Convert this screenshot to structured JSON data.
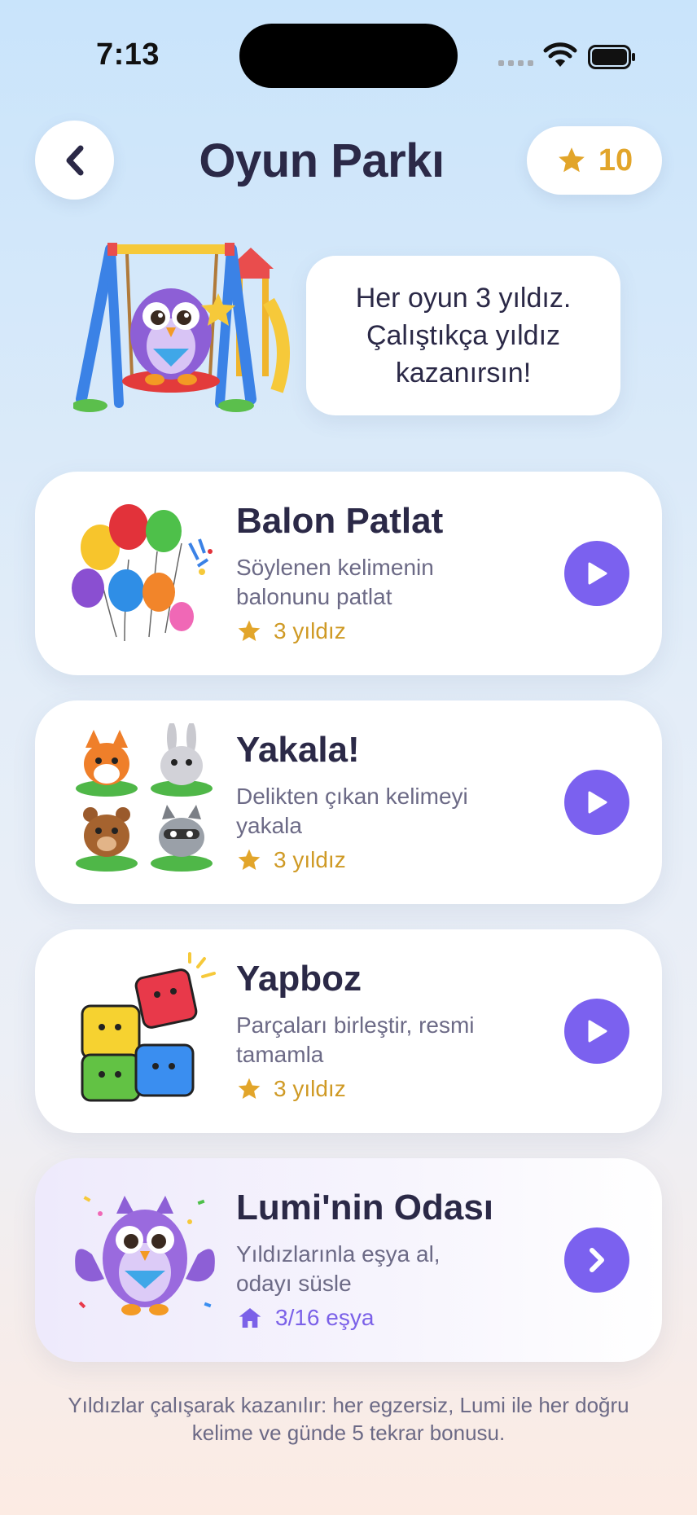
{
  "status_bar": {
    "time": "7:13"
  },
  "header": {
    "title": "Oyun Parkı",
    "stars": "10"
  },
  "hero": {
    "message": "Her oyun 3 yıldız.\nÇalıştıkça yıldız\nkazanırsın!"
  },
  "games": [
    {
      "title": "Balon Patlat",
      "description": "Söylenen kelimenin balonunu patlat",
      "reward": "3 yıldız",
      "action_icon": "play-icon"
    },
    {
      "title": "Yakala!",
      "description": "Delikten çıkan kelimeyi yakala",
      "reward": "3 yıldız",
      "action_icon": "play-icon"
    },
    {
      "title": "Yapboz",
      "description": "Parçaları birleştir, resmi tamamla",
      "reward": "3 yıldız",
      "action_icon": "play-icon"
    }
  ],
  "room": {
    "title": "Lumi'nin Odası",
    "description": "Yıldızlarınla eşya al, odayı süsle",
    "progress": "3/16 eşya",
    "action_icon": "chevron-right-icon"
  },
  "footer": {
    "note": "Yıldızlar çalışarak kazanılır: her egzersiz, Lumi ile her doğru kelime ve günde 5 tekrar bonusu."
  },
  "colors": {
    "accent": "#7b61ef",
    "star": "#e2a52a",
    "title": "#2b2947"
  }
}
